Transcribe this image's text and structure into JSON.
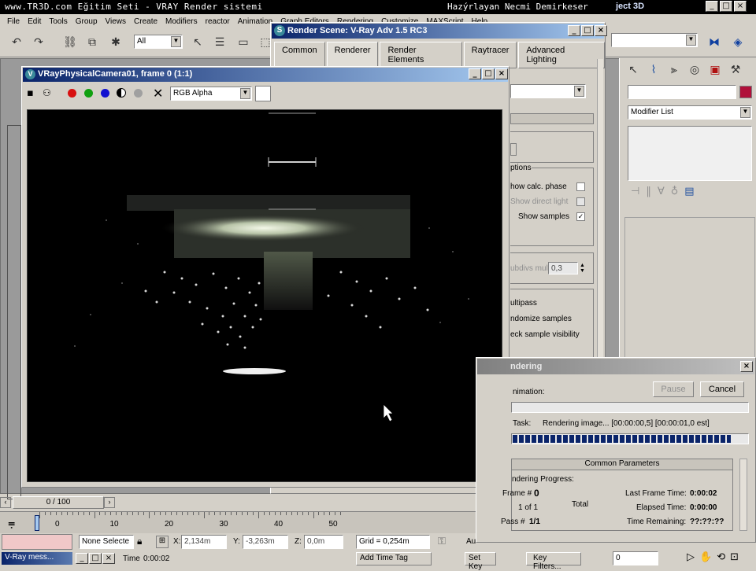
{
  "top_bar": {
    "left_text": "www.TR3D.com Eğitim Seti - VRAY Render sistemi",
    "right_text": "Hazýrlayan Necmi Demirkeser",
    "app_tail": "ject 3D"
  },
  "menu": [
    "File",
    "Edit",
    "Tools",
    "Group",
    "Views",
    "Create",
    "Modifiers",
    "reactor",
    "Animation",
    "Graph Editors",
    "Rendering",
    "Customize",
    "MAXScript",
    "Help"
  ],
  "toolbar": {
    "selection_filter": "All"
  },
  "render_scene": {
    "title": "Render Scene: V-Ray Adv 1.5 RC3",
    "tabs": [
      "Common",
      "Renderer",
      "Render Elements",
      "Raytracer",
      "Advanced Lighting"
    ],
    "options": {
      "group_label": "ptions",
      "show_calc_phase": "how calc. phase",
      "show_direct_light": "Show direct light",
      "show_samples": "Show samples",
      "subdivs_mult_label": "ubdivs mult.",
      "subdivs_mult_value": "0,3",
      "multipass": "ultipass",
      "randomize": "ndomize samples",
      "check_visibility": "eck sample visibility"
    }
  },
  "vfb": {
    "title": "VRayPhysicalCamera01, frame 0 (1:1)",
    "channel": "RGB Alpha"
  },
  "command_panel": {
    "modifier_list": "Modifier List"
  },
  "rendering_dialog": {
    "title": "ndering",
    "animation_label": "nimation:",
    "pause": "Pause",
    "cancel": "Cancel",
    "task_label": "Task:",
    "task_value": "Rendering image... [00:00:00,5] [00:00:01,0 est]",
    "common_params": "Common Parameters",
    "progress_label": "ndering Progress:",
    "frame_label": "Frame #",
    "frame_value": "0",
    "of_label": "1 of 1",
    "total_label": "Total",
    "pass_label": "Pass #",
    "pass_value": "1/1",
    "last_frame_label": "Last Frame Time:",
    "last_frame_value": "0:00:02",
    "elapsed_label": "Elapsed Time:",
    "elapsed_value": "0:00:00",
    "remaining_label": "Time Remaining:",
    "remaining_value": "??:??:??",
    "progress": 0.93
  },
  "timeline": {
    "frame_counter": "0 / 100",
    "ticks": [
      "0",
      "10",
      "20",
      "30",
      "40",
      "50"
    ]
  },
  "status_bar": {
    "selection": "None Selecte",
    "x_label": "X:",
    "x_value": "2,134m",
    "y_label": "Y:",
    "y_value": "-3,263m",
    "z_label": "Z:",
    "z_value": "0,0m",
    "grid": "Grid = 0,254m",
    "taskbar_item": "V-Ray mess...",
    "time_label": "Time",
    "time_value": "0:00:02",
    "add_time_tag": "Add Time Tag",
    "set_key": "Set Key",
    "key_filters": "Key Filters...",
    "frame_field": "0",
    "auto_label": "Au"
  }
}
